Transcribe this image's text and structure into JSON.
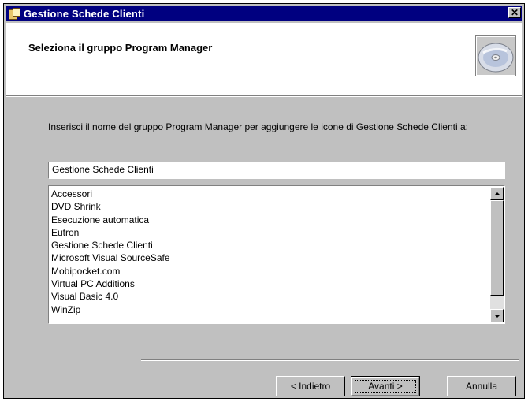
{
  "window": {
    "title": "Gestione Schede Clienti",
    "close_label": "✕"
  },
  "header": {
    "title": "Seleziona il gruppo Program Manager"
  },
  "body": {
    "instruction": "Inserisci il nome del gruppo Program Manager per aggiungere le icone di Gestione Schede Clienti a:",
    "group_name_value": "Gestione Schede Clienti",
    "groups": [
      "Accessori",
      "DVD Shrink",
      "Esecuzione automatica",
      "Eutron",
      "Gestione Schede Clienti",
      "Microsoft Visual SourceSafe",
      "Mobipocket.com",
      "Virtual PC Additions",
      "Visual Basic 4.0",
      "WinZip"
    ]
  },
  "buttons": {
    "back_label": "< Indietro",
    "next_label": "Avanti >",
    "cancel_label": "Annulla"
  },
  "colors": {
    "titlebar": "#000080",
    "window": "#c0c0c0",
    "header_bg": "#ffffff"
  },
  "icons": {
    "app": "installer-icon",
    "header": "cd-disc-icon"
  }
}
